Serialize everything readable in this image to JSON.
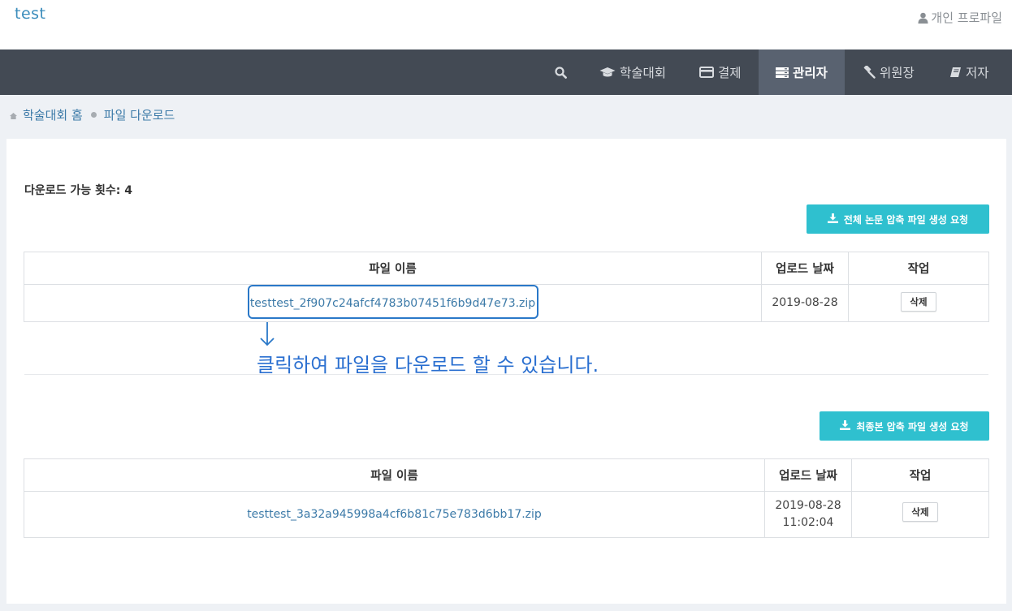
{
  "header": {
    "brand": "test",
    "profile_label": "개인 프로파일"
  },
  "nav": {
    "items": [
      {
        "label": "학술대회",
        "icon": "graduation-cap-icon"
      },
      {
        "label": "결제",
        "icon": "credit-card-icon"
      },
      {
        "label": "관리자",
        "icon": "server-icon",
        "active": true
      },
      {
        "label": "위원장",
        "icon": "gavel-icon"
      },
      {
        "label": "저자",
        "icon": "book-icon"
      }
    ]
  },
  "breadcrumb": {
    "home": "학술대회 홈",
    "current": "파일 다운로드"
  },
  "download_count": "다운로드 가능 횟수: 4",
  "section1": {
    "button_label": "전체 논문 압축 파일 생성 요청",
    "columns": [
      "파일 이름",
      "업로드 날짜",
      "작업"
    ],
    "rows": [
      {
        "file": "testtest_2f907c24afcf4783b07451f6b9d47e73.zip",
        "date": "2019-08-28",
        "action": "삭제"
      }
    ]
  },
  "annotation": "클릭하여 파일을 다운로드 할 수 있습니다.",
  "section2": {
    "button_label": "최종본 압축 파일 생성 요청",
    "columns": [
      "파일 이름",
      "업로드 날짜",
      "작업"
    ],
    "rows": [
      {
        "file": "testtest_3a32a945998a4cf6b81c75e783d6bb17.zip",
        "date": "2019-08-28",
        "time": "11:02:04",
        "action": "삭제"
      }
    ]
  },
  "colors": {
    "brand": "#3c8dbc",
    "navbar": "#434a54",
    "nav_active": "#596270",
    "accent_button": "#2fc0cf",
    "link": "#3c7aa8",
    "annotation": "#2a6fd0"
  }
}
